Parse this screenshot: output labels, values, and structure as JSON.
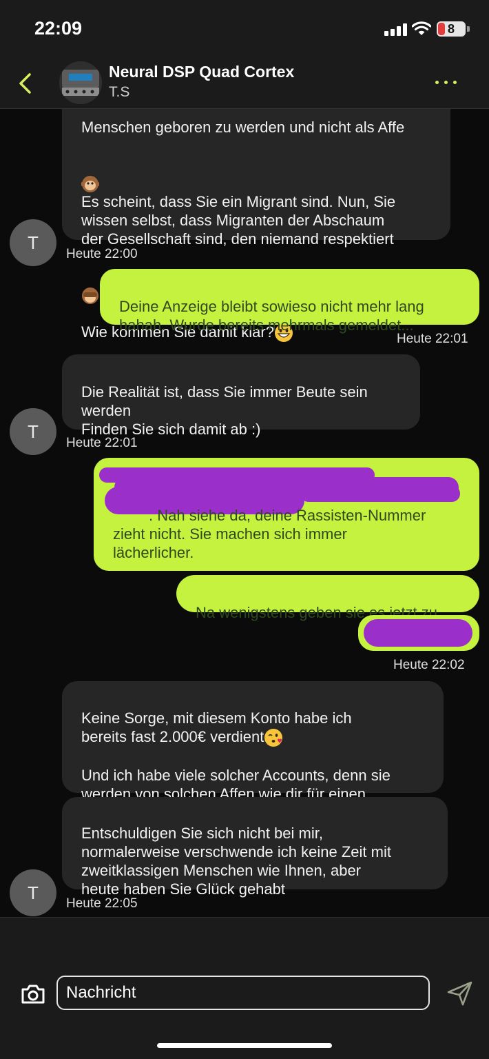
{
  "status_bar": {
    "time": "22:09",
    "battery_level": "8",
    "battery_color": "#e23c3c"
  },
  "header": {
    "title": "Neural DSP Quad Cortex",
    "subtitle": "T.S",
    "back_icon": "chevron-left-icon",
    "more_icon": "ellipsis-icon",
    "accent_color": "#d6f060"
  },
  "messages": {
    "m1": {
      "line0": "Menschen geboren zu werden und nicht als Affe",
      "line1": "Es scheint, dass Sie ein Migrant sind. Nun, Sie\nwissen selbst, dass Migranten der Abschaum\nder Gesellschaft sind, den niemand respektiert",
      "line2": "Wie kommen Sie damit klar?",
      "time": "Heute 22:00"
    },
    "m2": {
      "text": "Deine Anzeige bleibt sowieso nicht mehr lang\nhahah. Wurde bereits mehrmals gemeldet...",
      "time": "Heute 22:01"
    },
    "m3": {
      "text": "Die Realität ist, dass Sie immer Beute sein\nwerden\nFinden Sie sich damit ab :)",
      "time": "Heute 22:01"
    },
    "m4": {
      "text_line1": ". Nah siehe da, deine Rassisten-Nummer",
      "text_rest": "zieht nicht. Sie machen sich immer\nlächerlicher."
    },
    "m5": {
      "text": "Na wenigstens geben sie es jetzt zu"
    },
    "m6": {
      "time": "Heute 22:02"
    },
    "m7": {
      "line1": "Keine Sorge, mit diesem Konto habe ich\nbereits fast 2.000€ verdient",
      "line2": "Und ich habe viele solcher Accounts, denn sie\nwerden von solchen Affen wie dir für einen\nSpottpreis verkauft"
    },
    "m8": {
      "text": "Entschuldigen Sie sich nicht bei mir,\nnormalerweise verschwende ich keine Zeit mit\nzweitklassigen Menschen wie Ihnen, aber\nheute haben Sie Glück gehabt",
      "time": "Heute 22:05"
    }
  },
  "avatar_letter": "T",
  "composer": {
    "placeholder": "Nachricht",
    "camera_icon": "camera-icon",
    "send_icon": "send-icon"
  },
  "colors": {
    "outgoing_bubble": "#c4f23e",
    "incoming_bubble": "#262626",
    "redaction": "#9b2fc9"
  }
}
